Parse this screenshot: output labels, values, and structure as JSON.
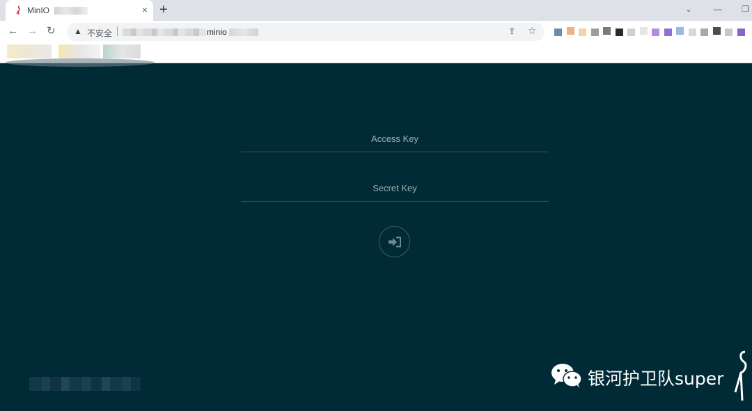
{
  "browser": {
    "tab": {
      "title": "MinIO",
      "close_icon": "×"
    },
    "new_tab_icon": "+",
    "window_controls": {
      "dropdown": "⌄",
      "minimize": "—",
      "restore": "❐"
    },
    "nav": {
      "back": "←",
      "forward": "→",
      "reload": "↻"
    },
    "address_bar": {
      "warning_icon": "▲",
      "security_label": "不安全",
      "host_visible": "minio",
      "share_icon": "⇪",
      "star_icon": "☆"
    },
    "extension_colors": [
      "#6e8aa8",
      "#e9b57a",
      "#f3d4a6",
      "#9c9c9c",
      "#7a7a7a",
      "#2a2a2a",
      "#cfcfcf",
      "#e6e6e6",
      "#b78be0",
      "#8f6fd8",
      "#9db7e3",
      "#d8d8d8",
      "#a8a8a8",
      "#4d4d4d",
      "#c8c8c8",
      "#8a63c9"
    ]
  },
  "login": {
    "access_key": {
      "placeholder": "Access Key",
      "value": ""
    },
    "secret_key": {
      "placeholder": "Secret Key",
      "value": ""
    },
    "submit_icon": "sign-in-icon"
  },
  "watermark": {
    "text": "银河护卫队super"
  },
  "colors": {
    "page_bg": "#012a37",
    "field_line": "#3a5660",
    "placeholder": "#9fb0b5"
  }
}
